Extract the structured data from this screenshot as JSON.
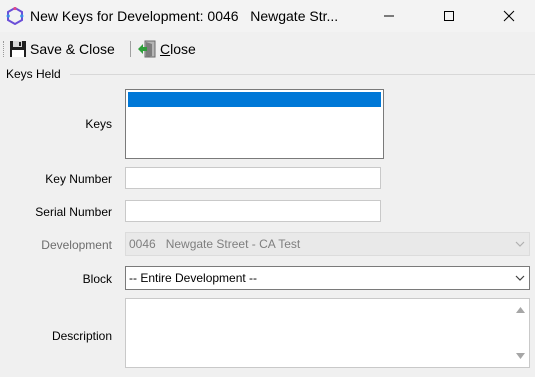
{
  "window": {
    "title": "New Keys for Development: 0046   Newgate Str..."
  },
  "toolbar": {
    "save_close_label": "Save & Close",
    "close_label": "Close"
  },
  "group": {
    "label": "Keys Held"
  },
  "form": {
    "keys_label": "Keys",
    "key_number_label": "Key Number",
    "key_number_value": "",
    "serial_number_label": "Serial Number",
    "serial_number_value": "",
    "development_label": "Development",
    "development_value": "0046   Newgate Street - CA Test",
    "block_label": "Block",
    "block_value": "-- Entire Development --",
    "description_label": "Description",
    "description_value": ""
  },
  "colors": {
    "selection": "#0078d7",
    "app_icon": "#6b4fd8"
  },
  "icons": [
    "app-icon",
    "minimize-icon",
    "maximize-icon",
    "close-icon",
    "save-icon",
    "exit-door-icon",
    "chevron-down-icon",
    "scroll-up-icon",
    "scroll-down-icon"
  ]
}
